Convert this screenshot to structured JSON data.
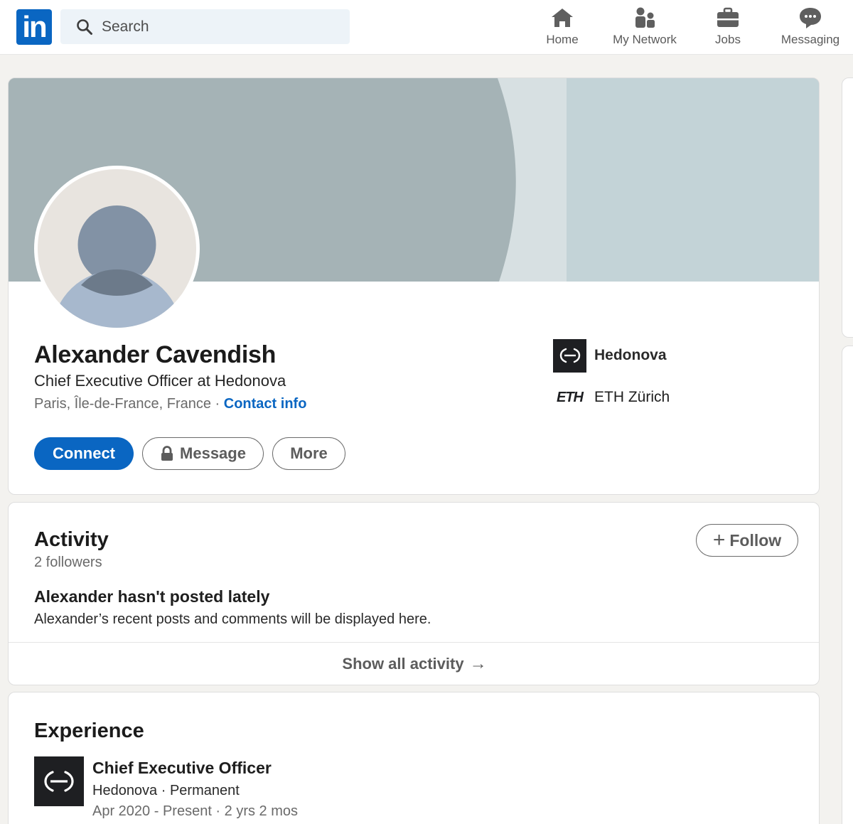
{
  "nav": {
    "logo_text": "in",
    "search_placeholder": "Search",
    "items": [
      {
        "label": "Home",
        "icon": "home-icon"
      },
      {
        "label": "My Network",
        "icon": "network-icon"
      },
      {
        "label": "Jobs",
        "icon": "briefcase-icon"
      },
      {
        "label": "Messaging",
        "icon": "messaging-icon"
      }
    ]
  },
  "profile": {
    "name": "Alexander Cavendish",
    "headline": "Chief Executive Officer at Hedonova",
    "location": "Paris, Île-de-France, France",
    "separator": " · ",
    "contact_info": "Contact info",
    "actions": {
      "connect": "Connect",
      "message": "Message",
      "more": "More"
    },
    "current_company": "Hedonova",
    "education_logo_text": "ETH",
    "education": "ETH Zürich"
  },
  "activity": {
    "title": "Activity",
    "followers": "2 followers",
    "follow_label": "Follow",
    "follow_plus": "+",
    "empty_title": "Alexander hasn't posted lately",
    "empty_desc": "Alexander’s recent posts and comments will be displayed here.",
    "show_all": "Show all activity",
    "arrow": "→"
  },
  "experience": {
    "title": "Experience",
    "items": [
      {
        "role": "Chief Executive Officer",
        "company": "Hedonova · Permanent",
        "dates": "Apr 2020 - Present · 2 yrs 2 mos"
      }
    ]
  },
  "colors": {
    "brand_blue": "#0a66c2",
    "banner": "#a5b3b6",
    "background": "#f3f2ef"
  }
}
